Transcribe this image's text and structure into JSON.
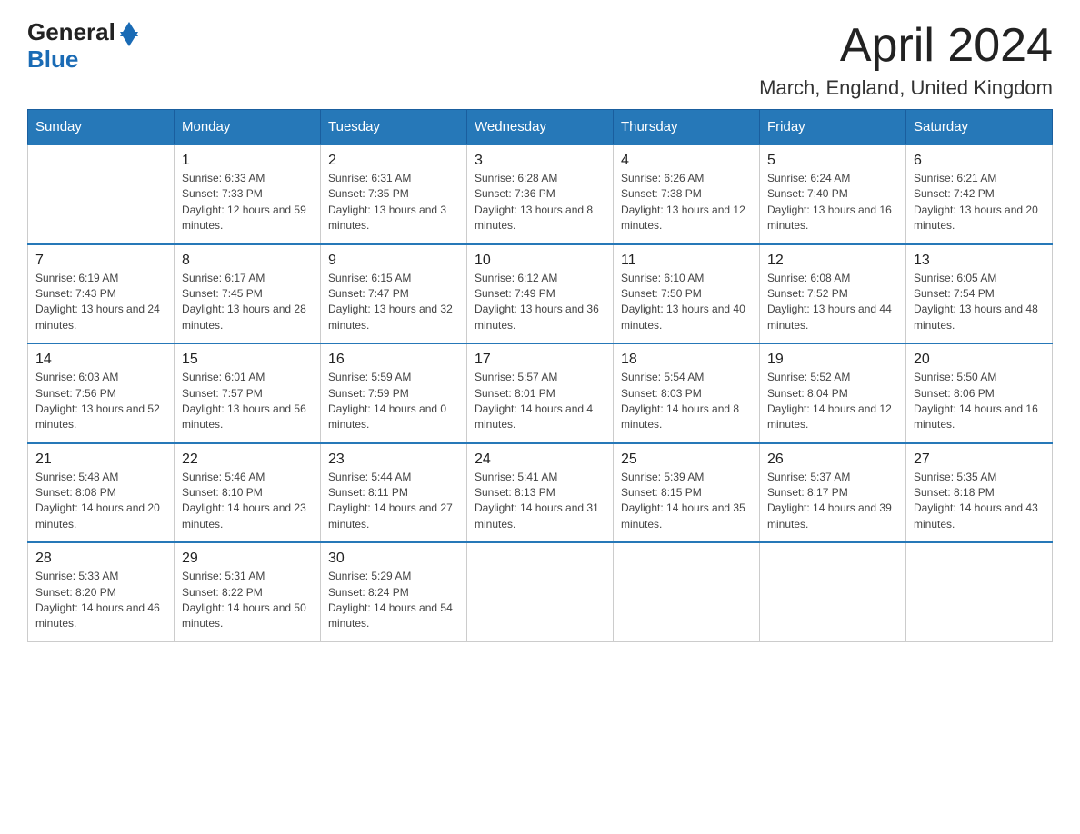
{
  "header": {
    "logo_general": "General",
    "logo_blue": "Blue",
    "title": "April 2024",
    "subtitle": "March, England, United Kingdom"
  },
  "days_of_week": [
    "Sunday",
    "Monday",
    "Tuesday",
    "Wednesday",
    "Thursday",
    "Friday",
    "Saturday"
  ],
  "weeks": [
    [
      {
        "day": "",
        "sunrise": "",
        "sunset": "",
        "daylight": ""
      },
      {
        "day": "1",
        "sunrise": "Sunrise: 6:33 AM",
        "sunset": "Sunset: 7:33 PM",
        "daylight": "Daylight: 12 hours and 59 minutes."
      },
      {
        "day": "2",
        "sunrise": "Sunrise: 6:31 AM",
        "sunset": "Sunset: 7:35 PM",
        "daylight": "Daylight: 13 hours and 3 minutes."
      },
      {
        "day": "3",
        "sunrise": "Sunrise: 6:28 AM",
        "sunset": "Sunset: 7:36 PM",
        "daylight": "Daylight: 13 hours and 8 minutes."
      },
      {
        "day": "4",
        "sunrise": "Sunrise: 6:26 AM",
        "sunset": "Sunset: 7:38 PM",
        "daylight": "Daylight: 13 hours and 12 minutes."
      },
      {
        "day": "5",
        "sunrise": "Sunrise: 6:24 AM",
        "sunset": "Sunset: 7:40 PM",
        "daylight": "Daylight: 13 hours and 16 minutes."
      },
      {
        "day": "6",
        "sunrise": "Sunrise: 6:21 AM",
        "sunset": "Sunset: 7:42 PM",
        "daylight": "Daylight: 13 hours and 20 minutes."
      }
    ],
    [
      {
        "day": "7",
        "sunrise": "Sunrise: 6:19 AM",
        "sunset": "Sunset: 7:43 PM",
        "daylight": "Daylight: 13 hours and 24 minutes."
      },
      {
        "day": "8",
        "sunrise": "Sunrise: 6:17 AM",
        "sunset": "Sunset: 7:45 PM",
        "daylight": "Daylight: 13 hours and 28 minutes."
      },
      {
        "day": "9",
        "sunrise": "Sunrise: 6:15 AM",
        "sunset": "Sunset: 7:47 PM",
        "daylight": "Daylight: 13 hours and 32 minutes."
      },
      {
        "day": "10",
        "sunrise": "Sunrise: 6:12 AM",
        "sunset": "Sunset: 7:49 PM",
        "daylight": "Daylight: 13 hours and 36 minutes."
      },
      {
        "day": "11",
        "sunrise": "Sunrise: 6:10 AM",
        "sunset": "Sunset: 7:50 PM",
        "daylight": "Daylight: 13 hours and 40 minutes."
      },
      {
        "day": "12",
        "sunrise": "Sunrise: 6:08 AM",
        "sunset": "Sunset: 7:52 PM",
        "daylight": "Daylight: 13 hours and 44 minutes."
      },
      {
        "day": "13",
        "sunrise": "Sunrise: 6:05 AM",
        "sunset": "Sunset: 7:54 PM",
        "daylight": "Daylight: 13 hours and 48 minutes."
      }
    ],
    [
      {
        "day": "14",
        "sunrise": "Sunrise: 6:03 AM",
        "sunset": "Sunset: 7:56 PM",
        "daylight": "Daylight: 13 hours and 52 minutes."
      },
      {
        "day": "15",
        "sunrise": "Sunrise: 6:01 AM",
        "sunset": "Sunset: 7:57 PM",
        "daylight": "Daylight: 13 hours and 56 minutes."
      },
      {
        "day": "16",
        "sunrise": "Sunrise: 5:59 AM",
        "sunset": "Sunset: 7:59 PM",
        "daylight": "Daylight: 14 hours and 0 minutes."
      },
      {
        "day": "17",
        "sunrise": "Sunrise: 5:57 AM",
        "sunset": "Sunset: 8:01 PM",
        "daylight": "Daylight: 14 hours and 4 minutes."
      },
      {
        "day": "18",
        "sunrise": "Sunrise: 5:54 AM",
        "sunset": "Sunset: 8:03 PM",
        "daylight": "Daylight: 14 hours and 8 minutes."
      },
      {
        "day": "19",
        "sunrise": "Sunrise: 5:52 AM",
        "sunset": "Sunset: 8:04 PM",
        "daylight": "Daylight: 14 hours and 12 minutes."
      },
      {
        "day": "20",
        "sunrise": "Sunrise: 5:50 AM",
        "sunset": "Sunset: 8:06 PM",
        "daylight": "Daylight: 14 hours and 16 minutes."
      }
    ],
    [
      {
        "day": "21",
        "sunrise": "Sunrise: 5:48 AM",
        "sunset": "Sunset: 8:08 PM",
        "daylight": "Daylight: 14 hours and 20 minutes."
      },
      {
        "day": "22",
        "sunrise": "Sunrise: 5:46 AM",
        "sunset": "Sunset: 8:10 PM",
        "daylight": "Daylight: 14 hours and 23 minutes."
      },
      {
        "day": "23",
        "sunrise": "Sunrise: 5:44 AM",
        "sunset": "Sunset: 8:11 PM",
        "daylight": "Daylight: 14 hours and 27 minutes."
      },
      {
        "day": "24",
        "sunrise": "Sunrise: 5:41 AM",
        "sunset": "Sunset: 8:13 PM",
        "daylight": "Daylight: 14 hours and 31 minutes."
      },
      {
        "day": "25",
        "sunrise": "Sunrise: 5:39 AM",
        "sunset": "Sunset: 8:15 PM",
        "daylight": "Daylight: 14 hours and 35 minutes."
      },
      {
        "day": "26",
        "sunrise": "Sunrise: 5:37 AM",
        "sunset": "Sunset: 8:17 PM",
        "daylight": "Daylight: 14 hours and 39 minutes."
      },
      {
        "day": "27",
        "sunrise": "Sunrise: 5:35 AM",
        "sunset": "Sunset: 8:18 PM",
        "daylight": "Daylight: 14 hours and 43 minutes."
      }
    ],
    [
      {
        "day": "28",
        "sunrise": "Sunrise: 5:33 AM",
        "sunset": "Sunset: 8:20 PM",
        "daylight": "Daylight: 14 hours and 46 minutes."
      },
      {
        "day": "29",
        "sunrise": "Sunrise: 5:31 AM",
        "sunset": "Sunset: 8:22 PM",
        "daylight": "Daylight: 14 hours and 50 minutes."
      },
      {
        "day": "30",
        "sunrise": "Sunrise: 5:29 AM",
        "sunset": "Sunset: 8:24 PM",
        "daylight": "Daylight: 14 hours and 54 minutes."
      },
      {
        "day": "",
        "sunrise": "",
        "sunset": "",
        "daylight": ""
      },
      {
        "day": "",
        "sunrise": "",
        "sunset": "",
        "daylight": ""
      },
      {
        "day": "",
        "sunrise": "",
        "sunset": "",
        "daylight": ""
      },
      {
        "day": "",
        "sunrise": "",
        "sunset": "",
        "daylight": ""
      }
    ]
  ]
}
